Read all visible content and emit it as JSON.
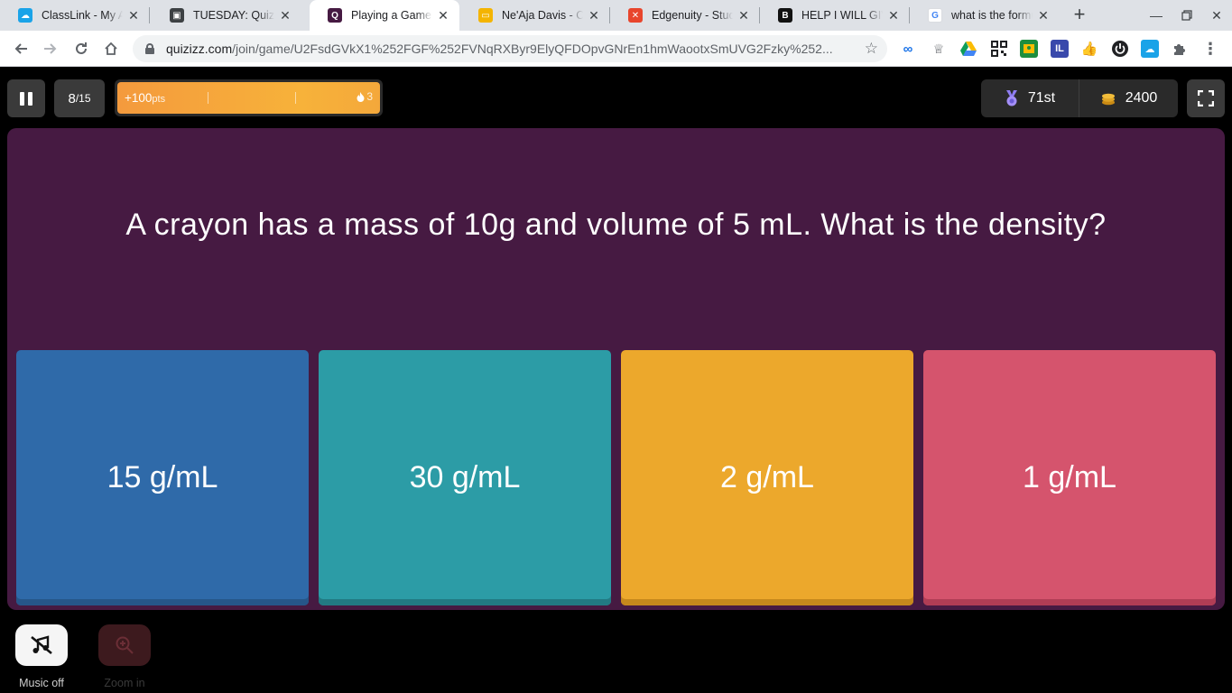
{
  "browser": {
    "tabs": [
      {
        "title": "ClassLink - My Apps",
        "favicon_color": "#1aa3e8",
        "favicon_glyph": "☁",
        "active": false
      },
      {
        "title": "TUESDAY: Quizizz",
        "favicon_color": "#3c4043",
        "favicon_glyph": "▣",
        "active": false
      },
      {
        "title": "Playing a Game - Quizizz",
        "favicon_color": "#461a42",
        "favicon_glyph": "Q",
        "active": true
      },
      {
        "title": "Ne'Aja Davis - Calendar",
        "favicon_color": "#f4b400",
        "favicon_glyph": "▭",
        "active": false
      },
      {
        "title": "Edgenuity - Student",
        "favicon_color": "#e8452c",
        "favicon_glyph": "✕",
        "active": false
      },
      {
        "title": "HELP I WILL GIVE",
        "favicon_color": "#111111",
        "favicon_glyph": "B",
        "active": false
      },
      {
        "title": "what is the formula",
        "favicon_color": "#ffffff",
        "favicon_glyph": "G",
        "active": false
      }
    ],
    "url_host": "quizizz.com",
    "url_path": "/join/game/U2FsdGVkX1%252FGF%252FVNqRXByr9ElyQFDOpvGNrEn1hmWaootxSmUVG2Fzky%252...",
    "extensions": [
      {
        "name": "extension-infinity-icon",
        "color": "#1a73e8",
        "glyph": "∞"
      },
      {
        "name": "extension-trophy-icon",
        "color": "#5f6368",
        "glyph": "♕"
      },
      {
        "name": "google-drive-icon",
        "color": "#0f9d58",
        "glyph": "▲"
      },
      {
        "name": "qr-code-icon",
        "color": "#202124",
        "glyph": "▦"
      },
      {
        "name": "google-classroom-icon",
        "color": "#1e8e3e",
        "glyph": "▤"
      },
      {
        "name": "immersive-reader-icon",
        "color": "#3949ab",
        "glyph": "I"
      },
      {
        "name": "thumbs-up-icon",
        "color": "#f4b400",
        "glyph": "👍"
      },
      {
        "name": "power-icon",
        "color": "#202124",
        "glyph": "⏻"
      },
      {
        "name": "classlink-icon",
        "color": "#1aa3e8",
        "glyph": "☁"
      },
      {
        "name": "puzzle-icon",
        "color": "#5f6368",
        "glyph": "✚"
      }
    ]
  },
  "game": {
    "question_number": "8",
    "question_total": "/15",
    "points": "+100",
    "points_unit": "pts",
    "streak_count": "3",
    "rank": "71st",
    "coins": "2400",
    "question": "A crayon has a mass of 10g and volume of 5 mL. What is the density?",
    "options": [
      "15 g/mL",
      "30 g/mL",
      "2 g/mL",
      "1 g/mL"
    ],
    "option_colors": [
      "#2f6aa9",
      "#2c9ca6",
      "#eca82c",
      "#d5546d"
    ],
    "panel_color": "#461a42",
    "music_label": "Music off",
    "zoom_label": "Zoom in"
  }
}
